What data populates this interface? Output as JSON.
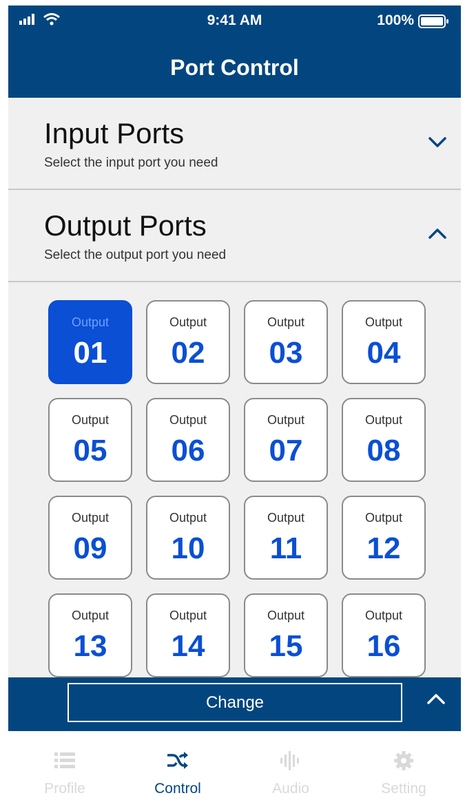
{
  "status_bar": {
    "time": "9:41 AM",
    "battery": "100%"
  },
  "header": {
    "title": "Port Control"
  },
  "input_section": {
    "title": "Input Ports",
    "subtitle": "Select the input port you need",
    "expanded": false
  },
  "output_section": {
    "title": "Output Ports",
    "subtitle": "Select the output port you need",
    "expanded": true
  },
  "ports": [
    {
      "label": "Output",
      "number": "01",
      "selected": true
    },
    {
      "label": "Output",
      "number": "02",
      "selected": false
    },
    {
      "label": "Output",
      "number": "03",
      "selected": false
    },
    {
      "label": "Output",
      "number": "04",
      "selected": false
    },
    {
      "label": "Output",
      "number": "05",
      "selected": false
    },
    {
      "label": "Output",
      "number": "06",
      "selected": false
    },
    {
      "label": "Output",
      "number": "07",
      "selected": false
    },
    {
      "label": "Output",
      "number": "08",
      "selected": false
    },
    {
      "label": "Output",
      "number": "09",
      "selected": false
    },
    {
      "label": "Output",
      "number": "10",
      "selected": false
    },
    {
      "label": "Output",
      "number": "11",
      "selected": false
    },
    {
      "label": "Output",
      "number": "12",
      "selected": false
    },
    {
      "label": "Output",
      "number": "13",
      "selected": false
    },
    {
      "label": "Output",
      "number": "14",
      "selected": false
    },
    {
      "label": "Output",
      "number": "15",
      "selected": false
    },
    {
      "label": "Output",
      "number": "16",
      "selected": false
    }
  ],
  "action_bar": {
    "change_label": "Change"
  },
  "tabs": [
    {
      "label": "Profile",
      "icon": "list-icon",
      "active": false
    },
    {
      "label": "Control",
      "icon": "shuffle-icon",
      "active": true
    },
    {
      "label": "Audio",
      "icon": "audio-wave-icon",
      "active": false
    },
    {
      "label": "Setting",
      "icon": "gear-icon",
      "active": false
    }
  ],
  "colors": {
    "primary": "#03467f",
    "accent": "#0a4fd4",
    "background": "#f0f0f0",
    "inactive_tab": "#d9d9d9"
  }
}
